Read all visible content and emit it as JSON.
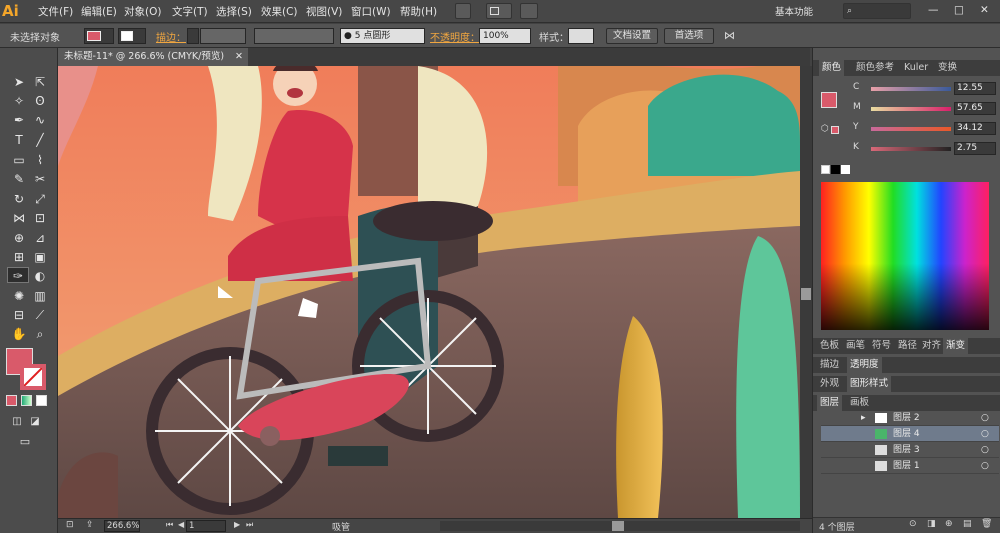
{
  "app": {
    "logo": "Ai",
    "workspace": "基本功能"
  },
  "menus": [
    "文件(F)",
    "编辑(E)",
    "对象(O)",
    "文字(T)",
    "选择(S)",
    "效果(C)",
    "视图(V)",
    "窗口(W)",
    "帮助(H)"
  ],
  "options": {
    "selection": "未选择对象",
    "stroke_label": "描边：",
    "brush": "5 点圆形",
    "opacity_label": "不透明度：",
    "opacity": "100%",
    "style_label": "样式：",
    "doc_setup": "文档设置",
    "preferences": "首选项"
  },
  "document": {
    "tab_title": "未标题-11* @ 266.6% (CMYK/预览)"
  },
  "status": {
    "zoom": "266.6%",
    "artboard": "1",
    "tool": "吸管"
  },
  "colors": {
    "fill": "#d95a6a",
    "accent": "#f4a62a"
  },
  "color_panel": {
    "tabs": [
      "颜色",
      "颜色参考",
      "Kuler",
      "变换"
    ],
    "sliders": [
      {
        "label": "C",
        "value": "12.55"
      },
      {
        "label": "M",
        "value": "57.65"
      },
      {
        "label": "Y",
        "value": "34.12"
      },
      {
        "label": "K",
        "value": "2.75"
      }
    ]
  },
  "panel_tabs2": [
    "色板",
    "画笔",
    "符号",
    "路径",
    "对齐",
    "渐变"
  ],
  "panel_tabs3": [
    "描边",
    "透明度"
  ],
  "panel_tabs4": [
    "外观",
    "图形样式"
  ],
  "layers_panel": {
    "tabs": [
      "图层",
      "画板"
    ],
    "layers": [
      {
        "name": "图层 2",
        "selected": false
      },
      {
        "name": "图层 4",
        "selected": true
      },
      {
        "name": "图层 3",
        "selected": false
      },
      {
        "name": "图层 1",
        "selected": false
      }
    ],
    "count": "4 个图层"
  }
}
